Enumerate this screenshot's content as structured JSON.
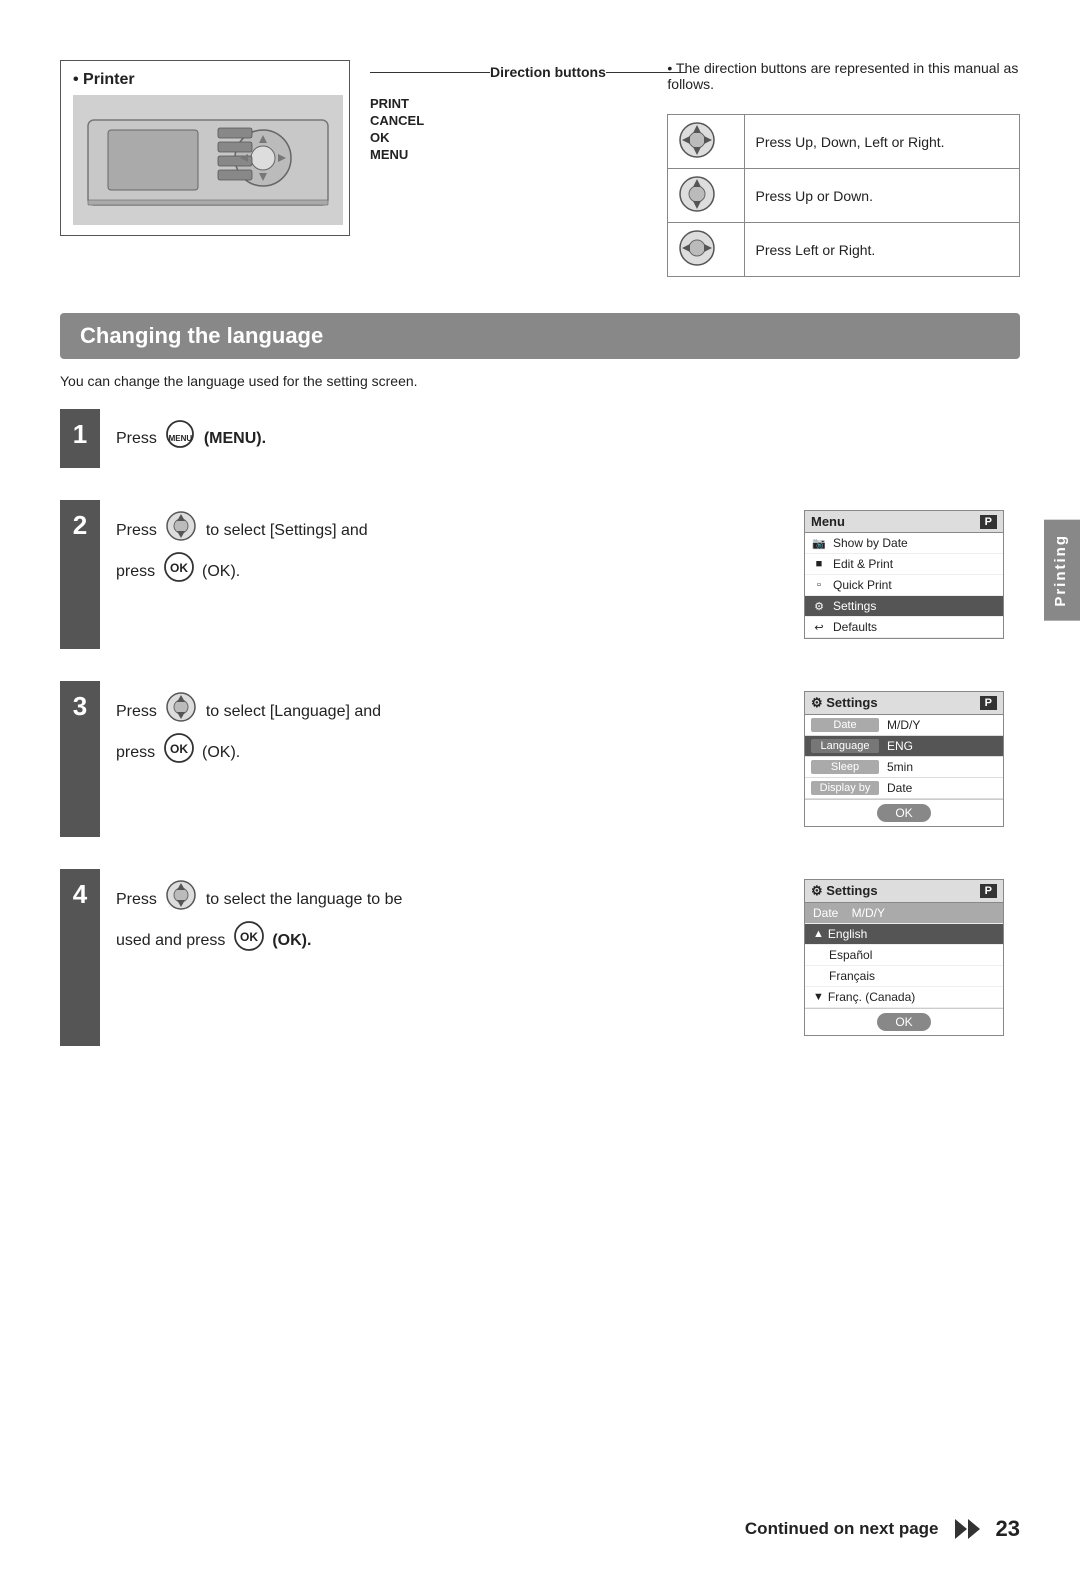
{
  "page": {
    "number": "23"
  },
  "top_section": {
    "printer_label": "• Printer",
    "direction_buttons_label": "Direction buttons",
    "direction_note": "• The direction buttons are represented in this manual as follows.",
    "button_labels": [
      "PRINT",
      "CANCEL",
      "OK",
      "MENU"
    ],
    "direction_table": [
      {
        "desc": "Press Up, Down, Left or Right."
      },
      {
        "desc": "Press Up or Down."
      },
      {
        "desc": "Press Left or Right."
      }
    ]
  },
  "section": {
    "title": "Changing the language",
    "intro": "You can change the language used for the setting screen."
  },
  "steps": [
    {
      "number": "1",
      "text_pre": "Press",
      "button": "MENU",
      "text_post": "(MENU).",
      "menu_label": "MENU",
      "has_screen": false
    },
    {
      "number": "2",
      "text_pre": "Press",
      "nav_type": "updown",
      "text_mid": "to select [Settings] and\npress",
      "ok_label": "OK",
      "text_post": "(OK).",
      "has_screen": true,
      "screen": {
        "type": "menu",
        "title": "Menu",
        "badge": "P",
        "rows": [
          {
            "label": "Show by Date",
            "icon": "📷",
            "highlighted": false
          },
          {
            "label": "Edit & Print",
            "icon": "□",
            "highlighted": false
          },
          {
            "label": "Quick Print",
            "icon": "□",
            "highlighted": false
          },
          {
            "label": "Settings",
            "icon": "🔧",
            "highlighted": true
          },
          {
            "label": "Defaults",
            "icon": "↩",
            "highlighted": false
          }
        ]
      }
    },
    {
      "number": "3",
      "text_pre": "Press",
      "nav_type": "updown",
      "text_mid": "to select [Language] and\npress",
      "ok_label": "OK",
      "text_post": "(OK).",
      "has_screen": true,
      "screen": {
        "type": "settings",
        "title": "Settings",
        "badge": "P",
        "fields": [
          {
            "label": "Date",
            "value": "M/D/Y"
          },
          {
            "label": "Language",
            "value": "ENG",
            "highlighted": true
          },
          {
            "label": "Sleep",
            "value": "5min"
          },
          {
            "label": "Display by",
            "value": "Date"
          }
        ],
        "ok_button": "OK"
      }
    },
    {
      "number": "4",
      "text_pre": "Press",
      "nav_type": "updown",
      "text_mid": "to select the language to be\nused and press",
      "ok_label": "OK",
      "text_post": "(OK).",
      "has_screen": true,
      "screen": {
        "type": "language",
        "title": "Settings",
        "badge": "P",
        "date_row": "Date    M/D/Y",
        "languages": [
          {
            "label": "English",
            "selected": true
          },
          {
            "label": "Español",
            "selected": false
          },
          {
            "label": "Français",
            "selected": false
          },
          {
            "label": "Franç. (Canada)",
            "selected": false
          }
        ],
        "ok_button": "OK"
      }
    }
  ],
  "side_tab": "Printing",
  "bottom": {
    "continued_text": "Continued on next page",
    "page_number": "23"
  }
}
